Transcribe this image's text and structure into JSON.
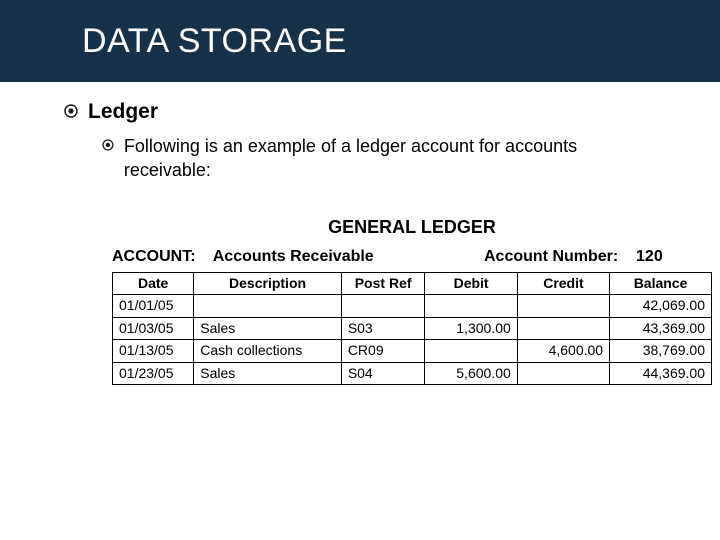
{
  "header": {
    "title": "DATA STORAGE"
  },
  "bullets": {
    "main": "Ledger",
    "sub": "Following is an example of a ledger account for accounts receivable:"
  },
  "ledger": {
    "title": "GENERAL LEDGER",
    "account_label": "ACCOUNT:",
    "account_name": "Accounts Receivable",
    "account_number_label": "Account Number:",
    "account_number": "120",
    "columns": {
      "date": "Date",
      "description": "Description",
      "post_ref": "Post Ref",
      "debit": "Debit",
      "credit": "Credit",
      "balance": "Balance"
    },
    "rows": [
      {
        "date": "01/01/05",
        "description": "",
        "post_ref": "",
        "debit": "",
        "credit": "",
        "balance": "42,069.00"
      },
      {
        "date": "01/03/05",
        "description": "Sales",
        "post_ref": "S03",
        "debit": "1,300.00",
        "credit": "",
        "balance": "43,369.00"
      },
      {
        "date": "01/13/05",
        "description": "Cash collections",
        "post_ref": "CR09",
        "debit": "",
        "credit": "4,600.00",
        "balance": "38,769.00"
      },
      {
        "date": "01/23/05",
        "description": "Sales",
        "post_ref": "S04",
        "debit": "5,600.00",
        "credit": "",
        "balance": "44,369.00"
      }
    ]
  },
  "chart_data": {
    "type": "table",
    "title": "GENERAL LEDGER — Accounts Receivable (Account Number 120)",
    "columns": [
      "Date",
      "Description",
      "Post Ref",
      "Debit",
      "Credit",
      "Balance"
    ],
    "rows": [
      [
        "01/01/05",
        "",
        "",
        "",
        "",
        42069.0
      ],
      [
        "01/03/05",
        "Sales",
        "S03",
        1300.0,
        "",
        43369.0
      ],
      [
        "01/13/05",
        "Cash collections",
        "CR09",
        "",
        4600.0,
        38769.0
      ],
      [
        "01/23/05",
        "Sales",
        "S04",
        5600.0,
        "",
        44369.0
      ]
    ]
  }
}
